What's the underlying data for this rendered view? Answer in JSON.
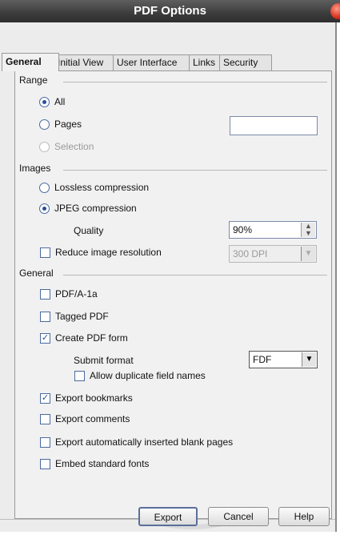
{
  "window": {
    "title": "PDF Options"
  },
  "tabs": [
    "General",
    "Initial View",
    "User Interface",
    "Links",
    "Security"
  ],
  "range": {
    "heading": "Range",
    "all_label": "All",
    "pages_label": "Pages",
    "pages_value": "",
    "selection_label": "Selection"
  },
  "images": {
    "heading": "Images",
    "lossless_label": "Lossless compression",
    "jpeg_label": "JPEG compression",
    "quality_label": "Quality",
    "quality_value": "90%",
    "reduce_label": "Reduce image resolution",
    "resolution_value": "300 DPI"
  },
  "general": {
    "heading": "General",
    "pdfa_label": "PDF/A-1a",
    "tagged_label": "Tagged PDF",
    "form_label": "Create PDF form",
    "submit_label": "Submit format",
    "submit_value": "FDF",
    "allow_dup_label": "Allow duplicate field names",
    "bookmarks_label": "Export bookmarks",
    "comments_label": "Export comments",
    "blank_pages_label": "Export automatically inserted blank pages",
    "embed_fonts_label": "Embed standard fonts"
  },
  "buttons": {
    "export": "Export",
    "cancel": "Cancel",
    "help": "Help"
  },
  "colors": {
    "accent": "#2a4f9a",
    "titlebar": "#3c3c3c",
    "close": "#d8301c"
  }
}
